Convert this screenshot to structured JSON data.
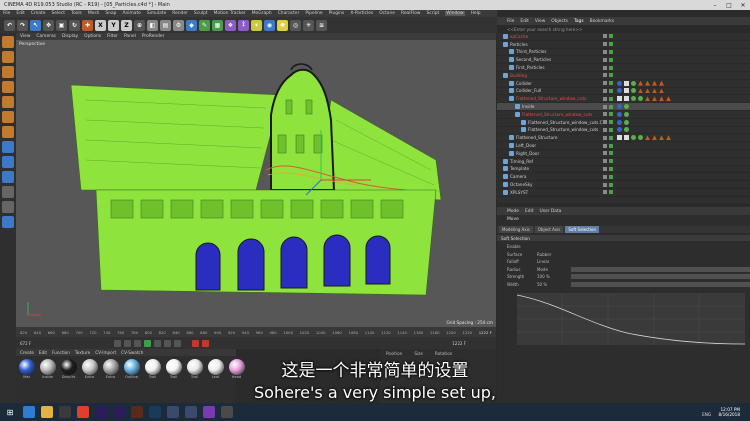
{
  "window": {
    "title": "CINEMA 4D R19.053 Studio (RC - R19) - [05_Particles.c4d *] - Main"
  },
  "menubar": [
    "File",
    "Edit",
    "Create",
    "Select",
    "Tools",
    "Mesh",
    "Snap",
    "Animate",
    "Simulate",
    "Render",
    "Sculpt",
    "Motion Tracker",
    "MoGraph",
    "Character",
    "Pipeline",
    "Plugins",
    "X-Particles",
    "Octane",
    "RealFlow",
    "Script",
    "Window",
    "Help"
  ],
  "menubar_active": "Window",
  "viewport": {
    "menu": [
      "View",
      "Cameras",
      "Display",
      "Options",
      "Filter",
      "Panel",
      "ProRender"
    ],
    "label": "Perspective",
    "grid_spacing": "Grid Spacing : 254 cm"
  },
  "timeline": {
    "ticks": [
      "620",
      "640",
      "660",
      "680",
      "700",
      "720",
      "740",
      "760",
      "780",
      "800",
      "820",
      "840",
      "860",
      "880",
      "900",
      "920",
      "940",
      "960",
      "980",
      "1000",
      "1020",
      "1040",
      "1060",
      "1080",
      "1100",
      "1120",
      "1140",
      "1160",
      "1180",
      "1200",
      "1220"
    ],
    "current": "1222 F",
    "start": "672 F",
    "end": "1222 F"
  },
  "materials": {
    "menu": [
      "Create",
      "Edit",
      "Function",
      "Texture",
      "CV-Import",
      "CV-Swatch"
    ],
    "items": [
      {
        "label": "Mat",
        "color": "#2f5fd0"
      },
      {
        "label": "Inside",
        "color": "#b8b8b8"
      },
      {
        "label": "Door/ht",
        "color": "#1e1e1e"
      },
      {
        "label": "Extra",
        "color": "#c9c9c9"
      },
      {
        "label": "Extra",
        "color": "#a8a8a8"
      },
      {
        "label": "Outline",
        "color": "#66b2e0"
      },
      {
        "label": "Trail",
        "color": "#f0f0f0"
      },
      {
        "label": "Trail",
        "color": "#f5f5f5"
      },
      {
        "label": "Trail",
        "color": "#e8e8e8"
      },
      {
        "label": "Leaf",
        "color": "#eeeeee"
      },
      {
        "label": "Head",
        "color": "#e7a0e0"
      }
    ]
  },
  "coords": {
    "labels": [
      "Position",
      "Size",
      "Rotation"
    ]
  },
  "objects": {
    "menu": [
      "File",
      "Edit",
      "View",
      "Objects",
      "Tags",
      "Bookmarks"
    ],
    "menu_active": "Tags",
    "search_placeholder": "<<Enter your search string here>>",
    "rows": [
      {
        "label": "xpCache",
        "indent": 0,
        "style": "red"
      },
      {
        "label": "Particles",
        "indent": 0,
        "style": ""
      },
      {
        "label": "Third_Particles",
        "indent": 1,
        "style": ""
      },
      {
        "label": "Second_Particles",
        "indent": 1,
        "style": ""
      },
      {
        "label": "First_Particles",
        "indent": 1,
        "style": ""
      },
      {
        "label": "Building",
        "indent": 0,
        "style": "red"
      },
      {
        "label": "Collider",
        "indent": 1,
        "style": ""
      },
      {
        "label": "Collider_Full",
        "indent": 1,
        "style": ""
      },
      {
        "label": "Flattened_Structure_window_cuts",
        "indent": 1,
        "style": "red"
      },
      {
        "label": "Inside",
        "indent": 2,
        "style": ""
      },
      {
        "label": "Flattened_Structure_window_cuts",
        "indent": 2,
        "style": "red"
      },
      {
        "label": "Flattened_Structure_window_cuts.Cut",
        "indent": 3,
        "style": ""
      },
      {
        "label": "Flattened_Structure_window_cuts",
        "indent": 3,
        "style": ""
      },
      {
        "label": "Flattened_Structure",
        "indent": 1,
        "style": ""
      },
      {
        "label": "Left_Door",
        "indent": 1,
        "style": ""
      },
      {
        "label": "Right_Door",
        "indent": 1,
        "style": ""
      },
      {
        "label": "Timing_Ref",
        "indent": 0,
        "style": ""
      },
      {
        "label": "Template",
        "indent": 0,
        "style": ""
      },
      {
        "label": "Camera",
        "indent": 0,
        "style": ""
      },
      {
        "label": "OctaneSky",
        "indent": 0,
        "style": ""
      },
      {
        "label": "XPLSYST",
        "indent": 0,
        "style": ""
      }
    ]
  },
  "attributes": {
    "menu": [
      "Mode",
      "Edit",
      "User Data"
    ],
    "title": "Move",
    "tabs": [
      "Modeling Axis",
      "Object Axis",
      "Soft Selection"
    ],
    "active_tab": "Soft Selection",
    "section": "Soft Selection",
    "rows": [
      {
        "label": "Enable",
        "value": ""
      },
      {
        "label": "Surface",
        "value": "Rubber"
      },
      {
        "label": "Falloff",
        "value": "Linear"
      },
      {
        "label": "Radius",
        "value": "Mode"
      },
      {
        "label": "Strength",
        "value": "100 %"
      },
      {
        "label": "Width",
        "value": "50 %"
      }
    ]
  },
  "subtitles": {
    "cn": "这是一个非常简单的设置",
    "en": "Sohere's a very simple set up,"
  },
  "taskbar": {
    "lang": "ENG",
    "time": "12:07 PM",
    "date": "8/16/2018"
  }
}
